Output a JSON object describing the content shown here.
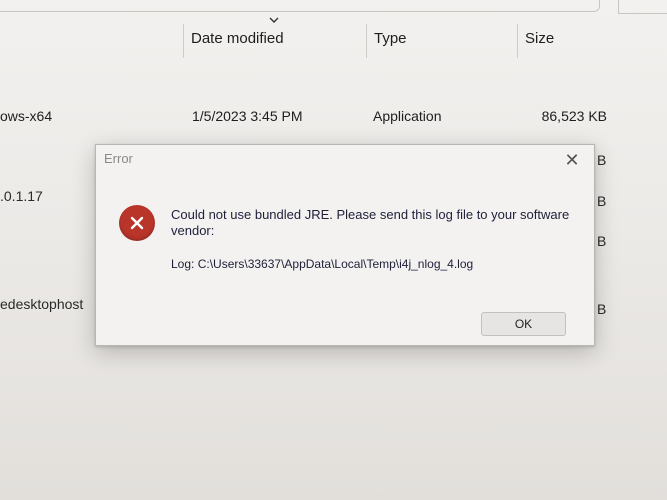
{
  "explorer": {
    "columns": {
      "date_modified": "Date modified",
      "type": "Type",
      "size": "Size"
    },
    "rows": [
      {
        "name_fragment": "ows-x64",
        "date": "1/5/2023 3:45 PM",
        "type": "Application",
        "size": "86,523 KB"
      },
      {
        "name_fragment": ".0.1.17",
        "size_fragment": "B"
      },
      {
        "name_fragment": "",
        "size_fragment": "B"
      },
      {
        "name_fragment": "edesktophost",
        "size_fragment": "B"
      }
    ],
    "extra_fragment": "B"
  },
  "dialog": {
    "title": "Error",
    "close_symbol": "✕",
    "message": "Could not use bundled JRE. Please send this log file to your software vendor:",
    "log_line": "Log: C:\\Users\\33637\\AppData\\Local\\Temp\\i4j_nlog_4.log",
    "ok_label": "OK",
    "icon": "error-x-icon",
    "icon_color": "#b9352a"
  }
}
